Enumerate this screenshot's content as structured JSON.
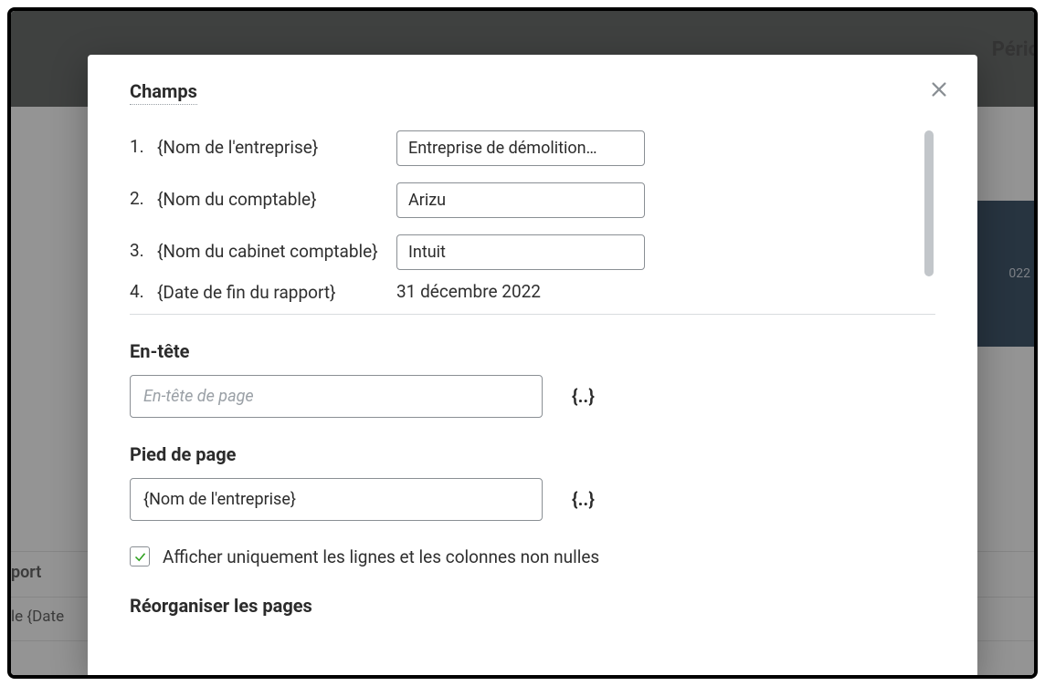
{
  "background": {
    "period_label": "Pério",
    "dark_block_text": "022",
    "left_row1": "port",
    "left_row2": "le {Date"
  },
  "modal": {
    "fields_title": "Champs",
    "fields": [
      {
        "num": "1.",
        "label": "{Nom de l'entreprise}",
        "value": "Entreprise de démolition…",
        "editable": true
      },
      {
        "num": "2.",
        "label": "{Nom du comptable}",
        "value": "Arizu",
        "editable": true
      },
      {
        "num": "3.",
        "label": "{Nom du cabinet comptable}",
        "value": "Intuit",
        "editable": true
      },
      {
        "num": "4.",
        "label": "{Date de fin du rapport}",
        "value": "31 décembre 2022",
        "editable": false
      }
    ],
    "header_section": {
      "title": "En-tête",
      "placeholder": "En-tête de page",
      "value": "",
      "token": "{..}"
    },
    "footer_section": {
      "title": "Pied de page",
      "value": "{Nom de l'entreprise}",
      "token": "{..}"
    },
    "checkbox_label": "Afficher uniquement les lignes et les colonnes non nulles",
    "reorder_title": "Réorganiser les pages"
  }
}
